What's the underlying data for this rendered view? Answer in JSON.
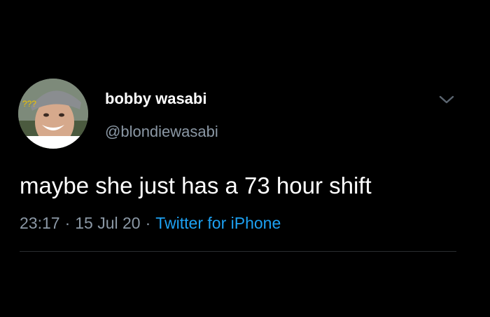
{
  "tweet": {
    "author": {
      "display_name": "bobby wasabi",
      "handle": "@blondiewasabi",
      "avatar_caption": "???"
    },
    "text": "maybe she just has a 73 hour shift",
    "meta": {
      "time": "23:17",
      "separator": "·",
      "date": "15 Jul 20",
      "source": "Twitter for iPhone"
    },
    "icons": {
      "more": "chevron-down-icon",
      "avatar": "user-avatar"
    },
    "colors": {
      "background": "#000000",
      "primary_text": "#ffffff",
      "secondary_text": "#8b98a5",
      "link": "#1da1f2",
      "divider": "#2a2d30"
    }
  }
}
